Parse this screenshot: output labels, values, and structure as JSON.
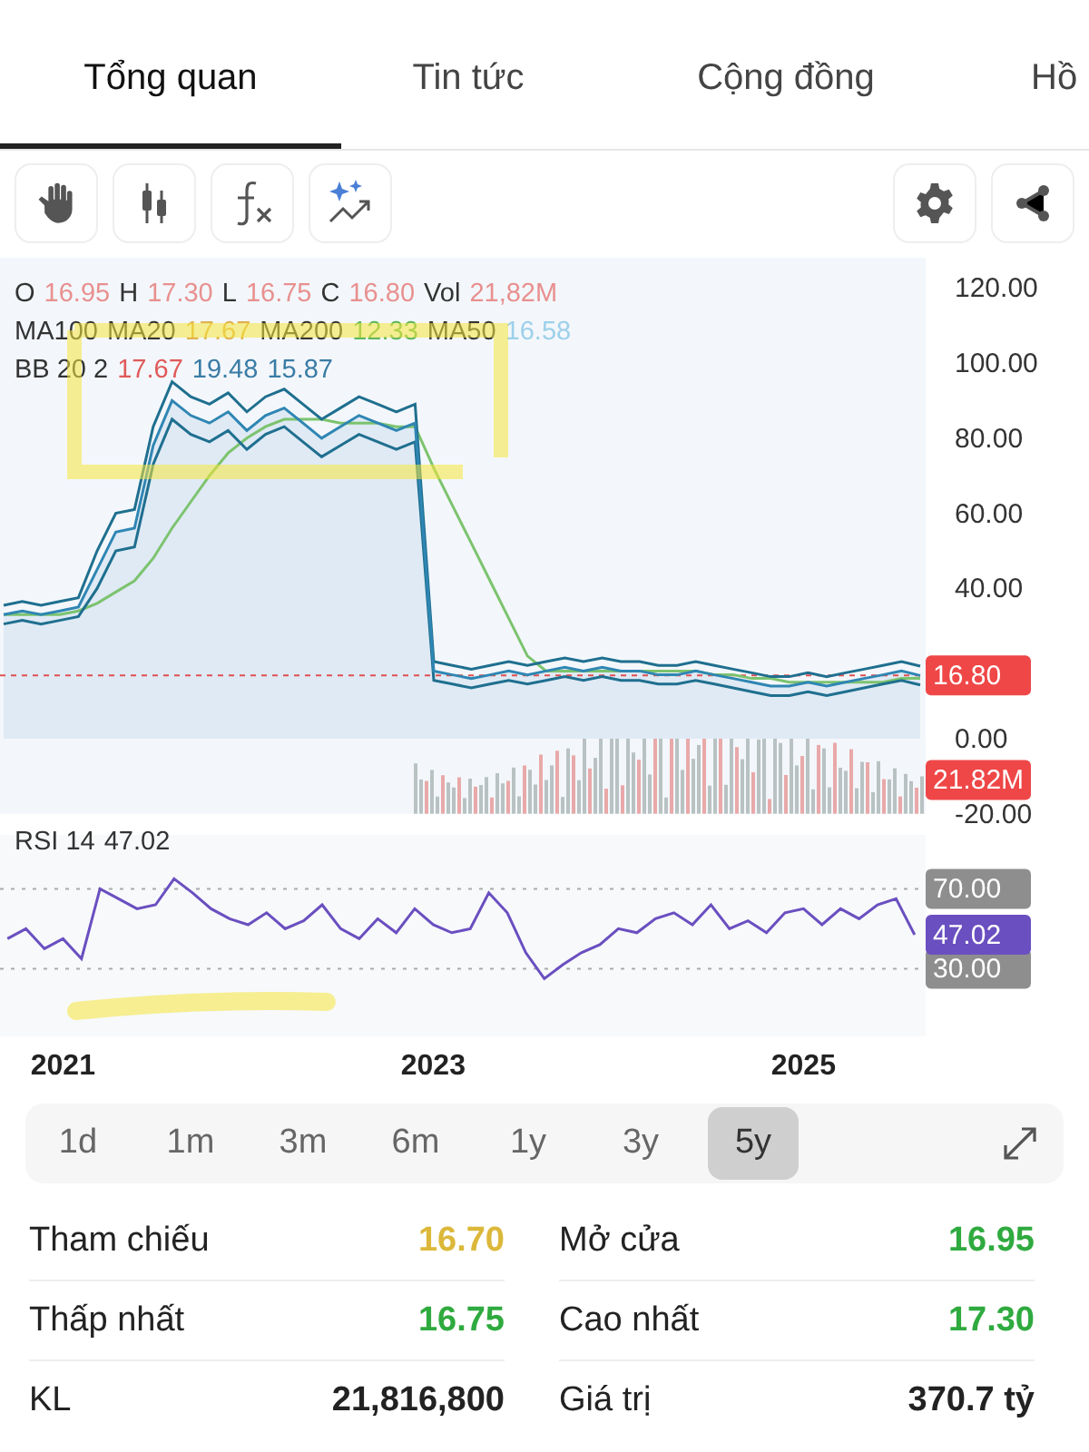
{
  "tabs": [
    {
      "label": "Tổng quan",
      "selected": true
    },
    {
      "label": "Tin tức",
      "selected": false
    },
    {
      "label": "Cộng đồng",
      "selected": false
    },
    {
      "label": "Hồ",
      "selected": false
    }
  ],
  "legend": {
    "lines": [
      {
        "items": [
          {
            "label": "O",
            "value": "16.95",
            "color": "#e8908f"
          },
          {
            "label": "H",
            "value": "17.30",
            "color": "#e8908f"
          },
          {
            "label": "L",
            "value": "16.75",
            "color": "#e8908f"
          },
          {
            "label": "C",
            "value": "16.80",
            "color": "#e8908f"
          },
          {
            "label": "Vol",
            "value": "21,82M",
            "color": "#e8908f"
          }
        ]
      },
      {
        "items": [
          {
            "label": "MA100"
          },
          {
            "label": "MA20",
            "value": "17.67",
            "color": "#e0b050"
          },
          {
            "label": "MA200",
            "value": "12.33",
            "color": "#5cb85c"
          },
          {
            "label": "MA50",
            "value": "16.58",
            "color": "#9dd0ea"
          }
        ]
      },
      {
        "items": [
          {
            "label": "BB 20 2"
          },
          {
            "value": "17.67",
            "color": "#e05a5a"
          },
          {
            "value": "19.48",
            "color": "#3a7ca5"
          },
          {
            "value": "15.87",
            "color": "#3a7ca5"
          }
        ]
      }
    ]
  },
  "price_chart": {
    "last_price": "16.80",
    "last_volume": "21.82M",
    "chart_data": {
      "type": "line",
      "series": [
        {
          "color": "#2f86b3",
          "values": [
            33,
            34,
            33,
            34,
            35,
            45,
            55,
            56,
            78,
            90,
            86,
            84,
            87,
            82,
            86,
            88,
            84,
            80,
            83,
            86,
            84,
            82,
            84,
            18,
            17,
            16,
            17,
            18,
            17,
            18,
            19,
            18,
            19,
            18,
            18,
            17,
            17,
            18,
            17,
            16,
            15,
            14,
            14,
            15,
            14,
            15,
            16,
            17,
            18,
            16.8
          ]
        },
        {
          "color": "#7cc36e",
          "values": [
            33,
            33,
            33,
            33,
            34,
            36,
            39,
            42,
            48,
            56,
            63,
            70,
            76,
            80,
            83,
            85,
            85,
            85,
            84,
            84,
            84,
            83,
            83,
            72,
            62,
            52,
            42,
            32,
            22,
            18,
            18,
            18,
            18,
            18,
            18,
            18,
            18,
            18,
            17,
            17,
            16,
            16,
            15,
            15,
            15,
            15,
            15,
            15,
            16,
            16
          ]
        },
        {
          "color": "#1f6f8f",
          "values": [
            35.5,
            36.5,
            35.5,
            36.5,
            37.5,
            50,
            60,
            61,
            83,
            95,
            91,
            89,
            92,
            87,
            91,
            93,
            89,
            85,
            88,
            91,
            89,
            87,
            89,
            20.5,
            19.5,
            18.5,
            19.5,
            20.5,
            19.5,
            20.5,
            21.5,
            20.5,
            21.5,
            20.5,
            20.5,
            19.5,
            19.5,
            20.5,
            19.5,
            18.5,
            17.5,
            16.5,
            16.5,
            17.5,
            16.5,
            17.5,
            18.5,
            19.5,
            20.5,
            19.3
          ]
        },
        {
          "color": "#1f6f8f",
          "values": [
            30.5,
            31.5,
            30.5,
            31.5,
            32.5,
            40,
            50,
            51,
            73,
            85,
            81,
            79,
            82,
            77,
            81,
            83,
            79,
            75,
            78,
            81,
            79,
            77,
            79,
            15.5,
            14.5,
            13.5,
            14.5,
            15.5,
            14.5,
            15.5,
            16.5,
            15.5,
            16.5,
            15.5,
            15.5,
            14.5,
            14.5,
            15.5,
            14.5,
            13.5,
            12.5,
            11.5,
            11.5,
            12.5,
            11.5,
            12.5,
            13.5,
            14.5,
            15.5,
            14.3
          ]
        }
      ],
      "ylim": [
        -20,
        128
      ],
      "yticks": [
        {
          "value": 120,
          "label": "120.00"
        },
        {
          "value": 100,
          "label": "100.00"
        },
        {
          "value": 80,
          "label": "80.00"
        },
        {
          "value": 60,
          "label": "60.00"
        },
        {
          "value": 40,
          "label": "40.00"
        },
        {
          "value": 0,
          "label": "0.00"
        },
        {
          "value": -20,
          "label": "-20.00"
        }
      ]
    }
  },
  "rsi_chart": {
    "label": "RSI 14",
    "value": "47.02",
    "last_value": "47.02",
    "chart_data": {
      "type": "line",
      "xlim": [
        2020.66,
        2025.66
      ],
      "ylim": [
        -4,
        97
      ],
      "x": [
        2020.7,
        2020.8,
        2020.9,
        2021.0,
        2021.1,
        2021.2,
        2021.3,
        2021.4,
        2021.5,
        2021.6,
        2021.7,
        2021.8,
        2021.9,
        2022.0,
        2022.1,
        2022.2,
        2022.3,
        2022.4,
        2022.5,
        2022.6,
        2022.7,
        2022.8,
        2022.9,
        2023.0,
        2023.1,
        2023.2,
        2023.3,
        2023.4,
        2023.5,
        2023.6,
        2023.7,
        2023.8,
        2023.9,
        2024.0,
        2024.1,
        2024.2,
        2024.3,
        2024.4,
        2024.5,
        2024.6,
        2024.7,
        2024.8,
        2024.9,
        2025.0,
        2025.1,
        2025.2,
        2025.3,
        2025.4,
        2025.5,
        2025.6
      ],
      "series": [
        {
          "color": "#6a4fc0",
          "values": [
            45,
            50,
            40,
            45,
            35,
            70,
            65,
            60,
            62,
            75,
            68,
            60,
            55,
            52,
            58,
            50,
            54,
            62,
            50,
            45,
            55,
            48,
            60,
            52,
            48,
            50,
            68,
            58,
            38,
            25,
            32,
            38,
            42,
            50,
            48,
            55,
            58,
            52,
            62,
            50,
            54,
            48,
            58,
            60,
            52,
            60,
            55,
            62,
            65,
            47
          ]
        }
      ],
      "yticks": [
        {
          "value": 70,
          "label": "70.00"
        },
        {
          "value": 30,
          "label": "30.00"
        }
      ],
      "xticks": [
        {
          "value": 2021,
          "label": "2021"
        },
        {
          "value": 2023,
          "label": "2023"
        },
        {
          "value": 2025,
          "label": "2025"
        }
      ]
    }
  },
  "periods": [
    {
      "label": "1d",
      "selected": false
    },
    {
      "label": "1m",
      "selected": false
    },
    {
      "label": "3m",
      "selected": false
    },
    {
      "label": "6m",
      "selected": false
    },
    {
      "label": "1y",
      "selected": false
    },
    {
      "label": "3y",
      "selected": false
    },
    {
      "label": "5y",
      "selected": true
    }
  ],
  "stats": [
    {
      "label": "Tham chiếu",
      "value": "16.70",
      "color": "#dcb83a"
    },
    {
      "label": "Mở cửa",
      "value": "16.95",
      "color": "#2faa3f"
    },
    {
      "label": "Thấp nhất",
      "value": "16.75",
      "color": "#2faa3f"
    },
    {
      "label": "Cao nhất",
      "value": "17.30",
      "color": "#2faa3f"
    },
    {
      "label": "KL",
      "value": "21,816,800",
      "color": "#222222"
    },
    {
      "label": "Giá trị",
      "value": "370.7 tỷ",
      "color": "#222222"
    }
  ]
}
